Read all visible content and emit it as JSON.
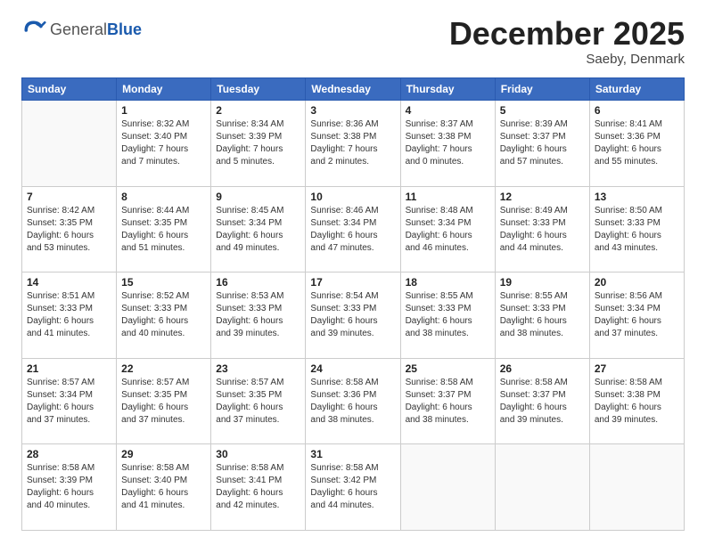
{
  "logo": {
    "general": "General",
    "blue": "Blue"
  },
  "title": "December 2025",
  "subtitle": "Saeby, Denmark",
  "columns": [
    "Sunday",
    "Monday",
    "Tuesday",
    "Wednesday",
    "Thursday",
    "Friday",
    "Saturday"
  ],
  "weeks": [
    [
      {
        "day": "",
        "detail": ""
      },
      {
        "day": "1",
        "detail": "Sunrise: 8:32 AM\nSunset: 3:40 PM\nDaylight: 7 hours\nand 7 minutes."
      },
      {
        "day": "2",
        "detail": "Sunrise: 8:34 AM\nSunset: 3:39 PM\nDaylight: 7 hours\nand 5 minutes."
      },
      {
        "day": "3",
        "detail": "Sunrise: 8:36 AM\nSunset: 3:38 PM\nDaylight: 7 hours\nand 2 minutes."
      },
      {
        "day": "4",
        "detail": "Sunrise: 8:37 AM\nSunset: 3:38 PM\nDaylight: 7 hours\nand 0 minutes."
      },
      {
        "day": "5",
        "detail": "Sunrise: 8:39 AM\nSunset: 3:37 PM\nDaylight: 6 hours\nand 57 minutes."
      },
      {
        "day": "6",
        "detail": "Sunrise: 8:41 AM\nSunset: 3:36 PM\nDaylight: 6 hours\nand 55 minutes."
      }
    ],
    [
      {
        "day": "7",
        "detail": "Sunrise: 8:42 AM\nSunset: 3:35 PM\nDaylight: 6 hours\nand 53 minutes."
      },
      {
        "day": "8",
        "detail": "Sunrise: 8:44 AM\nSunset: 3:35 PM\nDaylight: 6 hours\nand 51 minutes."
      },
      {
        "day": "9",
        "detail": "Sunrise: 8:45 AM\nSunset: 3:34 PM\nDaylight: 6 hours\nand 49 minutes."
      },
      {
        "day": "10",
        "detail": "Sunrise: 8:46 AM\nSunset: 3:34 PM\nDaylight: 6 hours\nand 47 minutes."
      },
      {
        "day": "11",
        "detail": "Sunrise: 8:48 AM\nSunset: 3:34 PM\nDaylight: 6 hours\nand 46 minutes."
      },
      {
        "day": "12",
        "detail": "Sunrise: 8:49 AM\nSunset: 3:33 PM\nDaylight: 6 hours\nand 44 minutes."
      },
      {
        "day": "13",
        "detail": "Sunrise: 8:50 AM\nSunset: 3:33 PM\nDaylight: 6 hours\nand 43 minutes."
      }
    ],
    [
      {
        "day": "14",
        "detail": "Sunrise: 8:51 AM\nSunset: 3:33 PM\nDaylight: 6 hours\nand 41 minutes."
      },
      {
        "day": "15",
        "detail": "Sunrise: 8:52 AM\nSunset: 3:33 PM\nDaylight: 6 hours\nand 40 minutes."
      },
      {
        "day": "16",
        "detail": "Sunrise: 8:53 AM\nSunset: 3:33 PM\nDaylight: 6 hours\nand 39 minutes."
      },
      {
        "day": "17",
        "detail": "Sunrise: 8:54 AM\nSunset: 3:33 PM\nDaylight: 6 hours\nand 39 minutes."
      },
      {
        "day": "18",
        "detail": "Sunrise: 8:55 AM\nSunset: 3:33 PM\nDaylight: 6 hours\nand 38 minutes."
      },
      {
        "day": "19",
        "detail": "Sunrise: 8:55 AM\nSunset: 3:33 PM\nDaylight: 6 hours\nand 38 minutes."
      },
      {
        "day": "20",
        "detail": "Sunrise: 8:56 AM\nSunset: 3:34 PM\nDaylight: 6 hours\nand 37 minutes."
      }
    ],
    [
      {
        "day": "21",
        "detail": "Sunrise: 8:57 AM\nSunset: 3:34 PM\nDaylight: 6 hours\nand 37 minutes."
      },
      {
        "day": "22",
        "detail": "Sunrise: 8:57 AM\nSunset: 3:35 PM\nDaylight: 6 hours\nand 37 minutes."
      },
      {
        "day": "23",
        "detail": "Sunrise: 8:57 AM\nSunset: 3:35 PM\nDaylight: 6 hours\nand 37 minutes."
      },
      {
        "day": "24",
        "detail": "Sunrise: 8:58 AM\nSunset: 3:36 PM\nDaylight: 6 hours\nand 38 minutes."
      },
      {
        "day": "25",
        "detail": "Sunrise: 8:58 AM\nSunset: 3:37 PM\nDaylight: 6 hours\nand 38 minutes."
      },
      {
        "day": "26",
        "detail": "Sunrise: 8:58 AM\nSunset: 3:37 PM\nDaylight: 6 hours\nand 39 minutes."
      },
      {
        "day": "27",
        "detail": "Sunrise: 8:58 AM\nSunset: 3:38 PM\nDaylight: 6 hours\nand 39 minutes."
      }
    ],
    [
      {
        "day": "28",
        "detail": "Sunrise: 8:58 AM\nSunset: 3:39 PM\nDaylight: 6 hours\nand 40 minutes."
      },
      {
        "day": "29",
        "detail": "Sunrise: 8:58 AM\nSunset: 3:40 PM\nDaylight: 6 hours\nand 41 minutes."
      },
      {
        "day": "30",
        "detail": "Sunrise: 8:58 AM\nSunset: 3:41 PM\nDaylight: 6 hours\nand 42 minutes."
      },
      {
        "day": "31",
        "detail": "Sunrise: 8:58 AM\nSunset: 3:42 PM\nDaylight: 6 hours\nand 44 minutes."
      },
      {
        "day": "",
        "detail": ""
      },
      {
        "day": "",
        "detail": ""
      },
      {
        "day": "",
        "detail": ""
      }
    ]
  ]
}
